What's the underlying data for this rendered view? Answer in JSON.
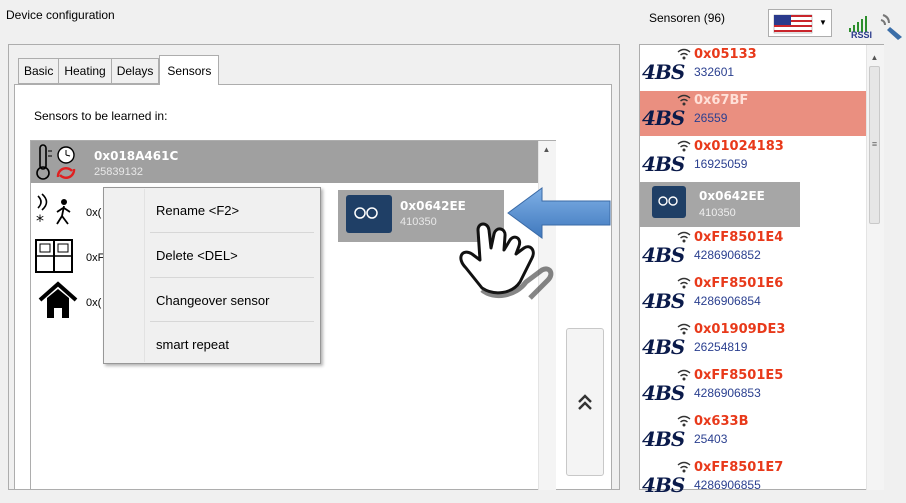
{
  "left_panel": {
    "title": "Device configuration",
    "tabs": [
      {
        "label": "Basic"
      },
      {
        "label": "Heating"
      },
      {
        "label": "Delays"
      },
      {
        "label": "Sensors"
      }
    ],
    "learn_label": "Sensors to be learned in:",
    "selected_sensor": {
      "id": "0x018A461C",
      "number": "25839132"
    },
    "partial_rows": [
      {
        "text": "0x("
      },
      {
        "text": "0xF"
      },
      {
        "text": "0x("
      }
    ]
  },
  "context_menu": {
    "items": [
      {
        "label": "Rename <F2>"
      },
      {
        "label": "Delete <DEL>"
      },
      {
        "label": "Changeover sensor"
      },
      {
        "label": "smart repeat"
      }
    ]
  },
  "dragged_item": {
    "id": "0x0642EE",
    "number": "410350"
  },
  "right_panel": {
    "title": "Sensoren (96)",
    "rssi_label": "RSSI",
    "sensors": [
      {
        "logo": "4BS",
        "id": "0x05133",
        "number": "332601"
      },
      {
        "logo": "4BS",
        "id": "0x67BF",
        "number": "26559"
      },
      {
        "logo": "4BS",
        "id": "0x01024183",
        "number": "16925059"
      },
      {
        "logo": "4BS",
        "id": "0xFF8501E4",
        "number": "4286906852"
      },
      {
        "logo": "4BS",
        "id": "0xFF8501E6",
        "number": "4286906854"
      },
      {
        "logo": "4BS",
        "id": "0x01909DE3",
        "number": "26254819"
      },
      {
        "logo": "4BS",
        "id": "0xFF8501E5",
        "number": "4286906853"
      },
      {
        "logo": "4BS",
        "id": "0x633B",
        "number": "25403"
      },
      {
        "logo": "4BS",
        "id": "0xFF8501E7",
        "number": "4286906855"
      }
    ],
    "ghost_item": {
      "id": "0x0642EE",
      "number": "410350"
    },
    "accent_colors": {
      "highlight": "#ea8f80",
      "id_text": "#e8391a",
      "number_text": "#2a3f8f",
      "arrow": "#4a86c8"
    }
  }
}
